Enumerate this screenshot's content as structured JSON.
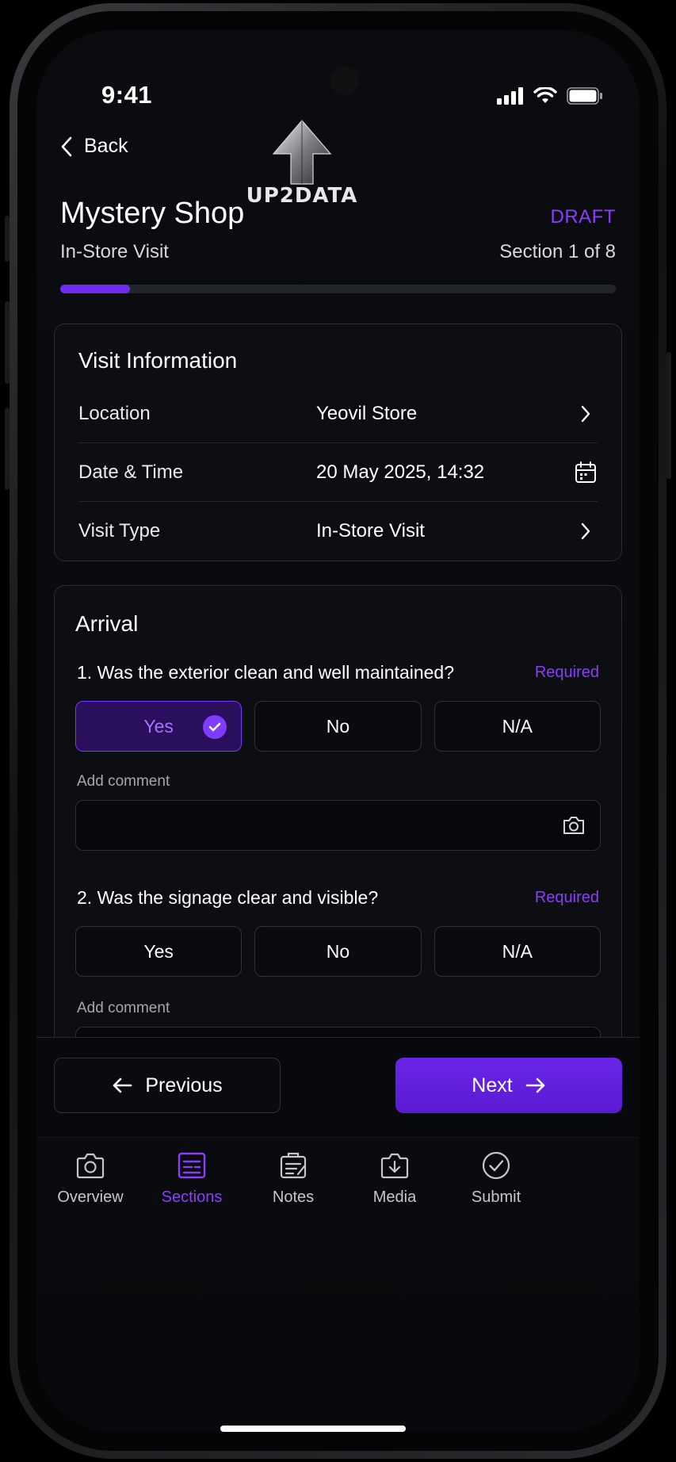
{
  "status_bar": {
    "time": "9:41"
  },
  "header": {
    "back_label": "Back",
    "logo_text": "UP2DATA",
    "title": "Mystery Shop",
    "status_badge": "DRAFT",
    "subtitle": "In-Store Visit",
    "section_indicator": "Section 1 of 8",
    "progress": 0.125
  },
  "visit_info": {
    "title": "Visit Information",
    "rows": [
      {
        "label": "Location",
        "value": "Yeovil Store",
        "icon": "chevron-right-icon"
      },
      {
        "label": "Date & Time",
        "value": "20 May 2025, 14:32",
        "icon": "calendar-icon"
      },
      {
        "label": "Visit Type",
        "value": "In-Store Visit",
        "icon": "chevron-right-icon"
      }
    ]
  },
  "arrival": {
    "title": "Arrival",
    "questions": [
      {
        "text": "1. Was the exterior clean and well maintained?",
        "required": "Required",
        "options": [
          "Yes",
          "No",
          "N/A"
        ],
        "selected": "Yes",
        "comment_label": "Add comment",
        "comment_value": ""
      },
      {
        "text": "2. Was the signage clear and visible?",
        "required": "Required",
        "options": [
          "Yes",
          "No",
          "N/A"
        ],
        "selected": null,
        "comment_label": "Add comment",
        "comment_value": ""
      }
    ]
  },
  "actions": {
    "previous": "Previous",
    "next": "Next"
  },
  "tabs": [
    {
      "label": "Overview",
      "icon": "camera-icon"
    },
    {
      "label": "Sections",
      "icon": "sections-icon",
      "active": true
    },
    {
      "label": "Notes",
      "icon": "notes-icon"
    },
    {
      "label": "Media",
      "icon": "media-icon"
    },
    {
      "label": "Submit",
      "icon": "check-circle-icon"
    }
  ],
  "colors": {
    "accent": "#7d3cff",
    "background": "#08090c"
  }
}
